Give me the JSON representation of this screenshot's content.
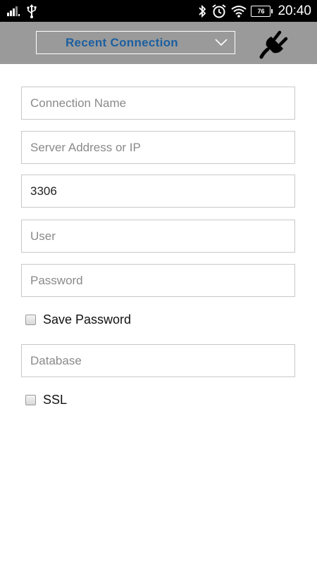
{
  "status_bar": {
    "time": "20:40",
    "battery": "76",
    "icons": [
      "signal-icon",
      "usb-icon",
      "bluetooth-icon",
      "alarm-icon",
      "wifi-icon",
      "battery-icon"
    ]
  },
  "header": {
    "spinner_label": "Recent Connection",
    "connect_icon": "plug-icon",
    "accent_color": "#1c5fa0",
    "background_color": "#9a9a9a"
  },
  "form": {
    "connection_name": {
      "placeholder": "Connection Name",
      "value": ""
    },
    "server_address": {
      "placeholder": "Server Address or IP",
      "value": ""
    },
    "port": {
      "placeholder": "",
      "value": "3306"
    },
    "user": {
      "placeholder": "User",
      "value": ""
    },
    "password": {
      "placeholder": "Password",
      "value": ""
    },
    "save_password": {
      "label": "Save Password",
      "checked": false
    },
    "database": {
      "placeholder": "Database",
      "value": ""
    },
    "ssl": {
      "label": "SSL",
      "checked": false
    }
  }
}
